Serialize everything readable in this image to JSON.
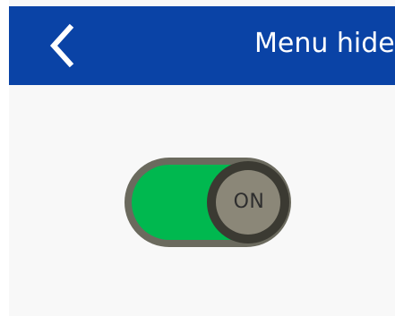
{
  "header": {
    "title": "Menu hide",
    "background_color": "#0a43a6",
    "back_icon": "chevron-left-icon"
  },
  "toggle": {
    "state_label": "ON",
    "is_on": true,
    "on_color": "#00b84f",
    "track_border_color": "#6b6a5e",
    "knob_color": "#8b8778"
  }
}
